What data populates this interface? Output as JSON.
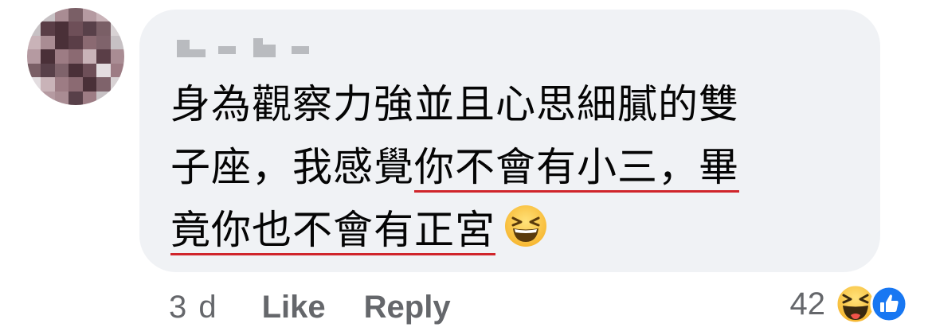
{
  "comment": {
    "author_name": "",
    "text_plain_1": "身為觀察力強並且心思細膩的雙\n子座，我感覺",
    "text_underlined_1": "你不會有小三，畢",
    "text_newline": "\n",
    "text_underlined_2": "竟你也不會有正宮",
    "emoji": "laughing-emoji",
    "underline_color": "#d0252b"
  },
  "actions": {
    "time": "3 d",
    "like_label": "Like",
    "reply_label": "Reply"
  },
  "reactions": {
    "count": "42",
    "icons": [
      "haha-reaction-icon",
      "like-reaction-icon"
    ]
  },
  "colors": {
    "bubble": "#f0f2f5",
    "text": "#050505",
    "secondary": "#65676b",
    "like_blue": "#1877f2"
  }
}
